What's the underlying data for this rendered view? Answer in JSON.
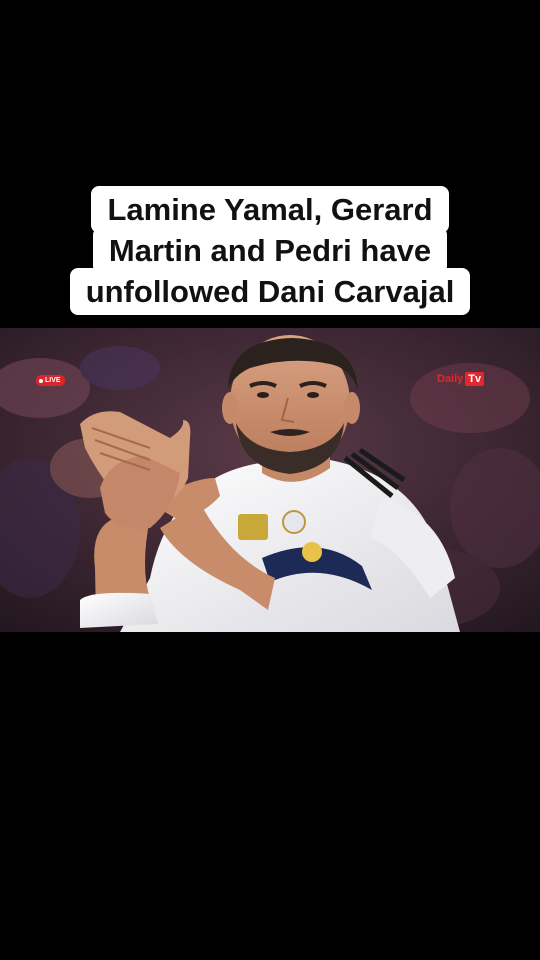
{
  "headline": {
    "lines": [
      "Lamine Yamal, Gerard",
      "Martin and Pedri have",
      "unfollowed Dani Carvajal"
    ]
  },
  "photo": {
    "subject": "footballer-applauding",
    "live_badge": "LIVE",
    "brand_a": "Daily",
    "brand_b": "Tv"
  },
  "colors": {
    "background": "#000000",
    "headline_bg": "#ffffff",
    "badge_red": "#e3262f"
  }
}
